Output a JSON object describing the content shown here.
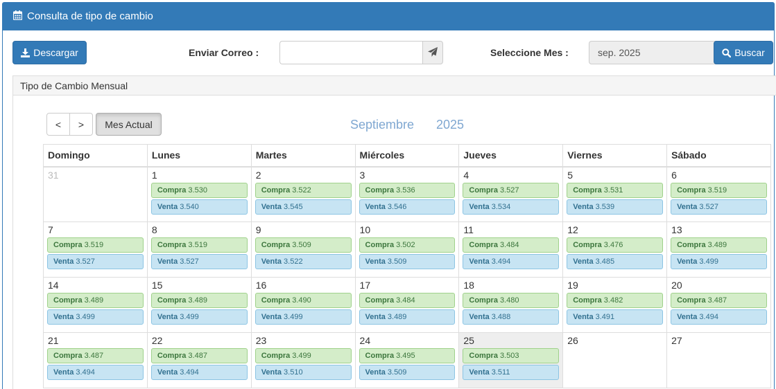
{
  "header": {
    "title": "Consulta de tipo de cambio"
  },
  "toolbar": {
    "download_label": "Descargar",
    "email_label": "Enviar Correo :",
    "email_value": "",
    "email_placeholder": "",
    "month_label": "Seleccione Mes :",
    "month_value": "sep. 2025",
    "search_label": "Buscar"
  },
  "panel": {
    "title": "Tipo de Cambio Mensual"
  },
  "calendar": {
    "prev_label": "<",
    "next_label": ">",
    "today_label": "Mes Actual",
    "month_name": "Septiembre",
    "year": "2025",
    "weekdays": [
      "Domingo",
      "Lunes",
      "Martes",
      "Miércoles",
      "Jueves",
      "Viernes",
      "Sábado"
    ],
    "buy_label": "Compra",
    "sell_label": "Venta",
    "weeks": [
      [
        {
          "day": "31",
          "other": true
        },
        {
          "day": "1",
          "buy": "3.530",
          "sell": "3.540"
        },
        {
          "day": "2",
          "buy": "3.522",
          "sell": "3.545"
        },
        {
          "day": "3",
          "buy": "3.536",
          "sell": "3.546"
        },
        {
          "day": "4",
          "buy": "3.527",
          "sell": "3.534"
        },
        {
          "day": "5",
          "buy": "3.531",
          "sell": "3.539"
        },
        {
          "day": "6",
          "buy": "3.519",
          "sell": "3.527"
        }
      ],
      [
        {
          "day": "7",
          "buy": "3.519",
          "sell": "3.527"
        },
        {
          "day": "8",
          "buy": "3.519",
          "sell": "3.527"
        },
        {
          "day": "9",
          "buy": "3.509",
          "sell": "3.522"
        },
        {
          "day": "10",
          "buy": "3.502",
          "sell": "3.509"
        },
        {
          "day": "11",
          "buy": "3.484",
          "sell": "3.494"
        },
        {
          "day": "12",
          "buy": "3.476",
          "sell": "3.485"
        },
        {
          "day": "13",
          "buy": "3.489",
          "sell": "3.499"
        }
      ],
      [
        {
          "day": "14",
          "buy": "3.489",
          "sell": "3.499"
        },
        {
          "day": "15",
          "buy": "3.489",
          "sell": "3.499"
        },
        {
          "day": "16",
          "buy": "3.490",
          "sell": "3.499"
        },
        {
          "day": "17",
          "buy": "3.484",
          "sell": "3.489"
        },
        {
          "day": "18",
          "buy": "3.480",
          "sell": "3.488"
        },
        {
          "day": "19",
          "buy": "3.482",
          "sell": "3.491"
        },
        {
          "day": "20",
          "buy": "3.487",
          "sell": "3.494"
        }
      ],
      [
        {
          "day": "21",
          "buy": "3.487",
          "sell": "3.494"
        },
        {
          "day": "22",
          "buy": "3.487",
          "sell": "3.494"
        },
        {
          "day": "23",
          "buy": "3.499",
          "sell": "3.510"
        },
        {
          "day": "24",
          "buy": "3.495",
          "sell": "3.509"
        },
        {
          "day": "25",
          "buy": "3.503",
          "sell": "3.511",
          "today": true
        },
        {
          "day": "26"
        },
        {
          "day": "27"
        }
      ]
    ]
  },
  "colors": {
    "primary": "#337ab7",
    "title_text": "#7fa7d1",
    "buy_bg": "#d4edc9",
    "sell_bg": "#c7e4f3",
    "today_bg": "#eeeeee"
  },
  "icons": {
    "header": "calendar-icon",
    "download": "download-icon",
    "send": "paper-plane-icon",
    "month_picker": "calendar-icon",
    "search": "search-icon"
  }
}
